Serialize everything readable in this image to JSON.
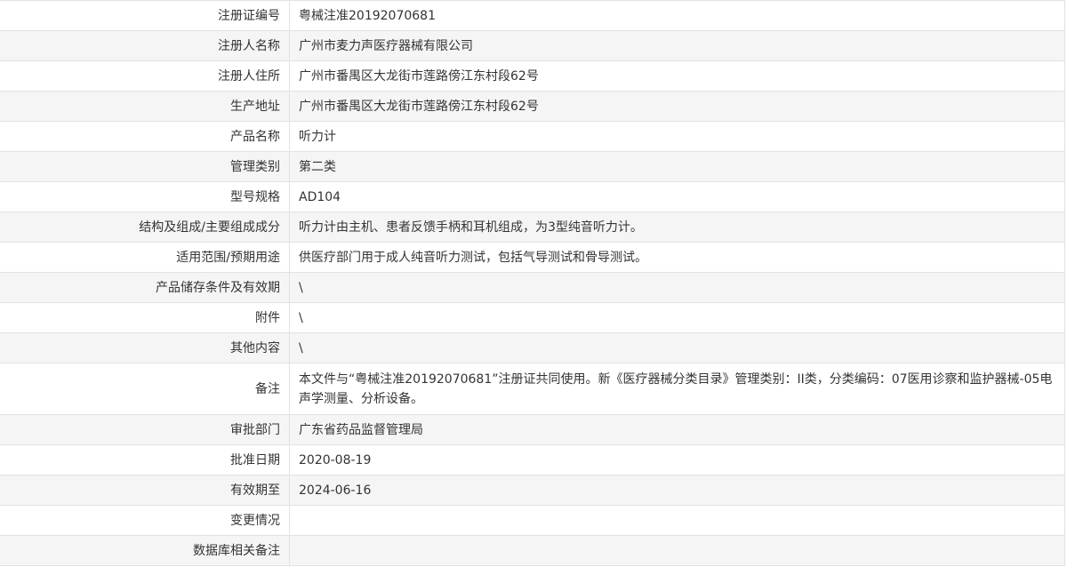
{
  "rows": [
    {
      "label": "注册证编号",
      "value": "粤械注准20192070681"
    },
    {
      "label": "注册人名称",
      "value": "广州市麦力声医疗器械有限公司"
    },
    {
      "label": "注册人住所",
      "value": "广州市番禺区大龙街市莲路傍江东村段62号"
    },
    {
      "label": "生产地址",
      "value": "广州市番禺区大龙街市莲路傍江东村段62号"
    },
    {
      "label": "产品名称",
      "value": "听力计"
    },
    {
      "label": "管理类别",
      "value": "第二类"
    },
    {
      "label": "型号规格",
      "value": "AD104"
    },
    {
      "label": "结构及组成/主要组成成分",
      "value": "听力计由主机、患者反馈手柄和耳机组成，为3型纯音听力计。"
    },
    {
      "label": "适用范围/预期用途",
      "value": "供医疗部门用于成人纯音听力测试，包括气导测试和骨导测试。"
    },
    {
      "label": "产品储存条件及有效期",
      "value": "\\"
    },
    {
      "label": "附件",
      "value": "\\"
    },
    {
      "label": "其他内容",
      "value": "\\"
    },
    {
      "label": "备注",
      "value": "本文件与“粤械注准20192070681”注册证共同使用。新《医疗器械分类目录》管理类别：II类，分类编码：07医用诊察和监护器械-05电声学测量、分析设备。"
    },
    {
      "label": "审批部门",
      "value": "广东省药品监督管理局"
    },
    {
      "label": "批准日期",
      "value": "2020-08-19"
    },
    {
      "label": "有效期至",
      "value": "2024-06-16"
    },
    {
      "label": "变更情况",
      "value": ""
    },
    {
      "label": "数据库相关备注",
      "value": ""
    }
  ]
}
